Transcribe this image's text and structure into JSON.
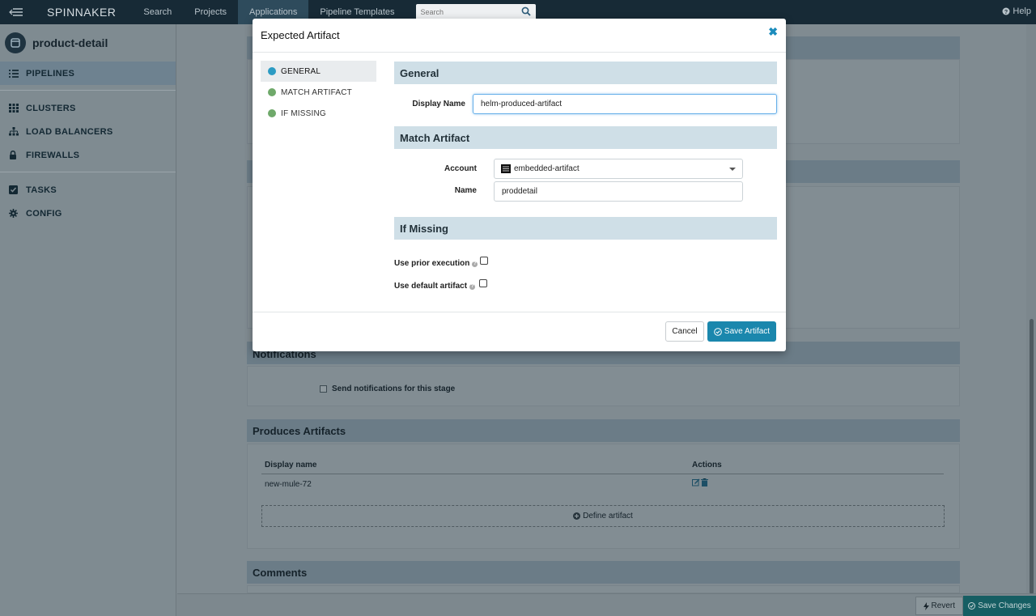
{
  "topnav": {
    "brand": "SPINNAKER",
    "links": [
      "Search",
      "Projects",
      "Applications",
      "Pipeline Templates"
    ],
    "search_placeholder": "Search",
    "help": "Help"
  },
  "sidebar": {
    "app_name": "product-detail",
    "items": [
      "PIPELINES",
      "CLUSTERS",
      "LOAD BALANCERS",
      "FIREWALLS",
      "TASKS",
      "CONFIG"
    ]
  },
  "background": {
    "notifications_title": "Notifications",
    "send_notifications_label": "Send notifications for this stage",
    "produces_artifacts_title": "Produces Artifacts",
    "col_display_name": "Display name",
    "col_actions": "Actions",
    "artifact_row": "new-mule-72",
    "define_artifact": "Define artifact",
    "comments_title": "Comments",
    "revert": "Revert",
    "save_changes": "Save Changes"
  },
  "modal": {
    "title": "Expected Artifact",
    "nav": [
      {
        "label": "GENERAL",
        "color": "#2b9bc3"
      },
      {
        "label": "MATCH ARTIFACT",
        "color": "#6fa96a"
      },
      {
        "label": "IF MISSING",
        "color": "#6fa96a"
      }
    ],
    "general": {
      "title": "General",
      "display_name_label": "Display Name",
      "display_name_value": "helm-produced-artifact"
    },
    "match": {
      "title": "Match Artifact",
      "account_label": "Account",
      "account_value": "embedded-artifact",
      "name_label": "Name",
      "name_value": "proddetail"
    },
    "if_missing": {
      "title": "If Missing",
      "prior_label": "Use prior execution",
      "default_label": "Use default artifact"
    },
    "cancel": "Cancel",
    "save": "Save Artifact"
  }
}
